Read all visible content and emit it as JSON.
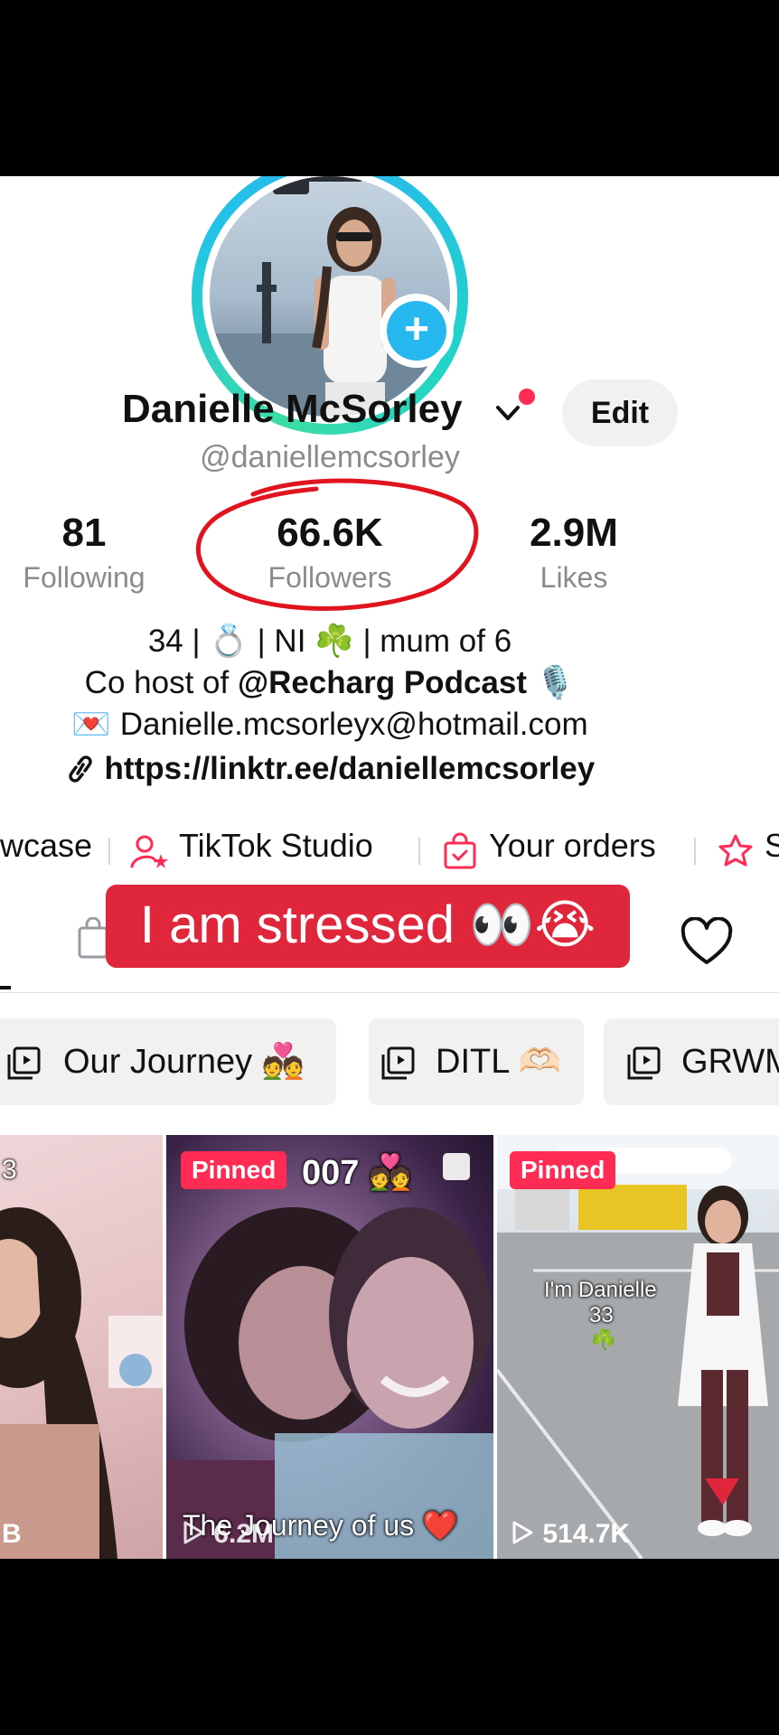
{
  "profile": {
    "display_name": "Danielle McSorley",
    "username": "@daniellemcsorley",
    "edit_label": "Edit",
    "add_icon": "plus-icon",
    "verified_dropdown_icon": "chevron-down-icon"
  },
  "stats": {
    "following": {
      "value": "81",
      "label": "Following"
    },
    "followers": {
      "value": "66.6K",
      "label": "Followers"
    },
    "likes": {
      "value": "2.9M",
      "label": "Likes"
    }
  },
  "bio": {
    "line1": "34 | 💍 | NI ☘️ | mum of 6",
    "line2_prefix": "Co host of ",
    "line2_mention": "@Recharg Podcast",
    "line2_emoji": "🎙️",
    "line3_emoji": "💌",
    "line3_email": "Danielle.mcsorleyx@hotmail.com",
    "link": "https://linktr.ee/daniellemcsorley"
  },
  "shortcuts": [
    {
      "label": "wcase"
    },
    {
      "label": "TikTok Studio",
      "icon": "user-star-icon"
    },
    {
      "label": "Your orders",
      "icon": "shopping-bag-icon"
    },
    {
      "label": "S",
      "icon": "star-icon"
    }
  ],
  "caption_overlay": "I am stressed 👀😭",
  "playlists": [
    {
      "label": "Our Journey 💑"
    },
    {
      "label": "DITL 🫶🏻"
    },
    {
      "label": "GRWM"
    }
  ],
  "videos": [
    {
      "top_text": "3",
      "bottom_text": "B"
    },
    {
      "badge": "Pinned",
      "top_text": "007 💑",
      "caption": "The Journey of us ❤️",
      "views": "6.2M"
    },
    {
      "badge": "Pinned",
      "caption_line1": "I'm Danielle",
      "caption_line2": "33",
      "caption_emoji": "☘️",
      "views": "514.7K"
    }
  ],
  "colors": {
    "accent": "#fe2c55",
    "caption_bg": "#e0263a",
    "avatar_ring": "#21d4c7",
    "plus_badge": "#28b8f0",
    "annotation_circle": "#e0141e"
  }
}
